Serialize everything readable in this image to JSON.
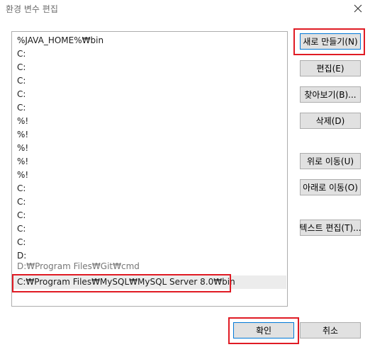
{
  "window": {
    "title": "환경 변수 편집"
  },
  "paths": {
    "items": [
      {
        "text": "%JAVA_HOME%₩bin"
      },
      {
        "text": "C:"
      },
      {
        "text": "C:"
      },
      {
        "text": "C:"
      },
      {
        "text": "C:"
      },
      {
        "text": "C:"
      },
      {
        "text": "%!"
      },
      {
        "text": "%!"
      },
      {
        "text": "%!"
      },
      {
        "text": "%!"
      },
      {
        "text": "%!"
      },
      {
        "text": "C:"
      },
      {
        "text": "C:"
      },
      {
        "text": "C:"
      },
      {
        "text": "C:"
      },
      {
        "text": "C:"
      },
      {
        "text": "D:"
      },
      {
        "text": "D:₩Program Files₩Git₩cmd"
      },
      {
        "text": "C:₩Program Files₩MySQL₩MySQL Server 8.0₩bin"
      }
    ]
  },
  "buttons": {
    "new": "새로 만들기(N)",
    "edit": "편집(E)",
    "browse": "찾아보기(B)...",
    "delete": "삭제(D)",
    "move_up": "위로 이동(U)",
    "move_down": "아래로 이동(O)",
    "edit_text": "텍스트 편집(T)...",
    "ok": "확인",
    "cancel": "취소"
  },
  "colors": {
    "highlight": "#e01b24",
    "selection": "#ececec",
    "button_bg": "#e1e1e1",
    "primary_border": "#0078d7"
  }
}
